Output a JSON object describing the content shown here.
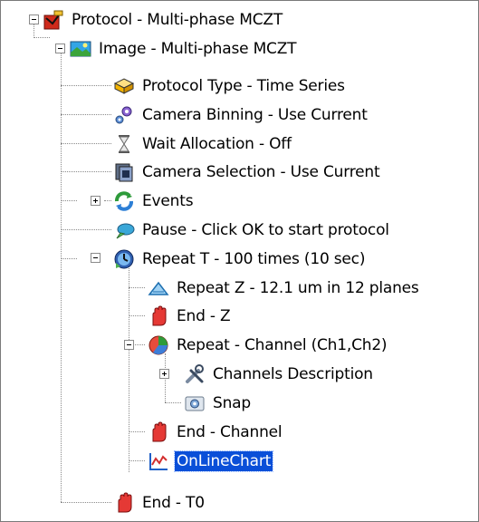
{
  "tree": {
    "nodes": [
      {
        "label": "Protocol - Multi-phase MCZT",
        "icon": "protocol-icon"
      },
      {
        "label": "Image - Multi-phase MCZT",
        "icon": "image-icon"
      },
      {
        "label": "Protocol Type - Time Series",
        "icon": "protocol-type-icon"
      },
      {
        "label": "Camera Binning - Use Current",
        "icon": "camera-binning-icon"
      },
      {
        "label": "Wait Allocation - Off",
        "icon": "hourglass-icon"
      },
      {
        "label": "Camera Selection - Use Current",
        "icon": "camera-selection-icon"
      },
      {
        "label": "Events",
        "icon": "events-icon"
      },
      {
        "label": "Pause - Click OK to start protocol",
        "icon": "pause-icon"
      },
      {
        "label": "Repeat T - 100 times (10 sec)",
        "icon": "repeat-time-icon"
      },
      {
        "label": "Repeat Z - 12.1 um in 12 planes",
        "icon": "repeat-z-icon"
      },
      {
        "label": "End - Z",
        "icon": "stop-hand-icon"
      },
      {
        "label": "Repeat - Channel (Ch1,Ch2)",
        "icon": "repeat-channel-icon"
      },
      {
        "label": "Channels Description",
        "icon": "tools-icon"
      },
      {
        "label": "Snap",
        "icon": "snap-camera-icon"
      },
      {
        "label": "End - Channel",
        "icon": "stop-hand-icon"
      },
      {
        "label": "OnLineChart",
        "icon": "chart-icon"
      },
      {
        "label": "End - T0",
        "icon": "stop-hand-icon"
      }
    ],
    "selected": "OnLineChart"
  }
}
